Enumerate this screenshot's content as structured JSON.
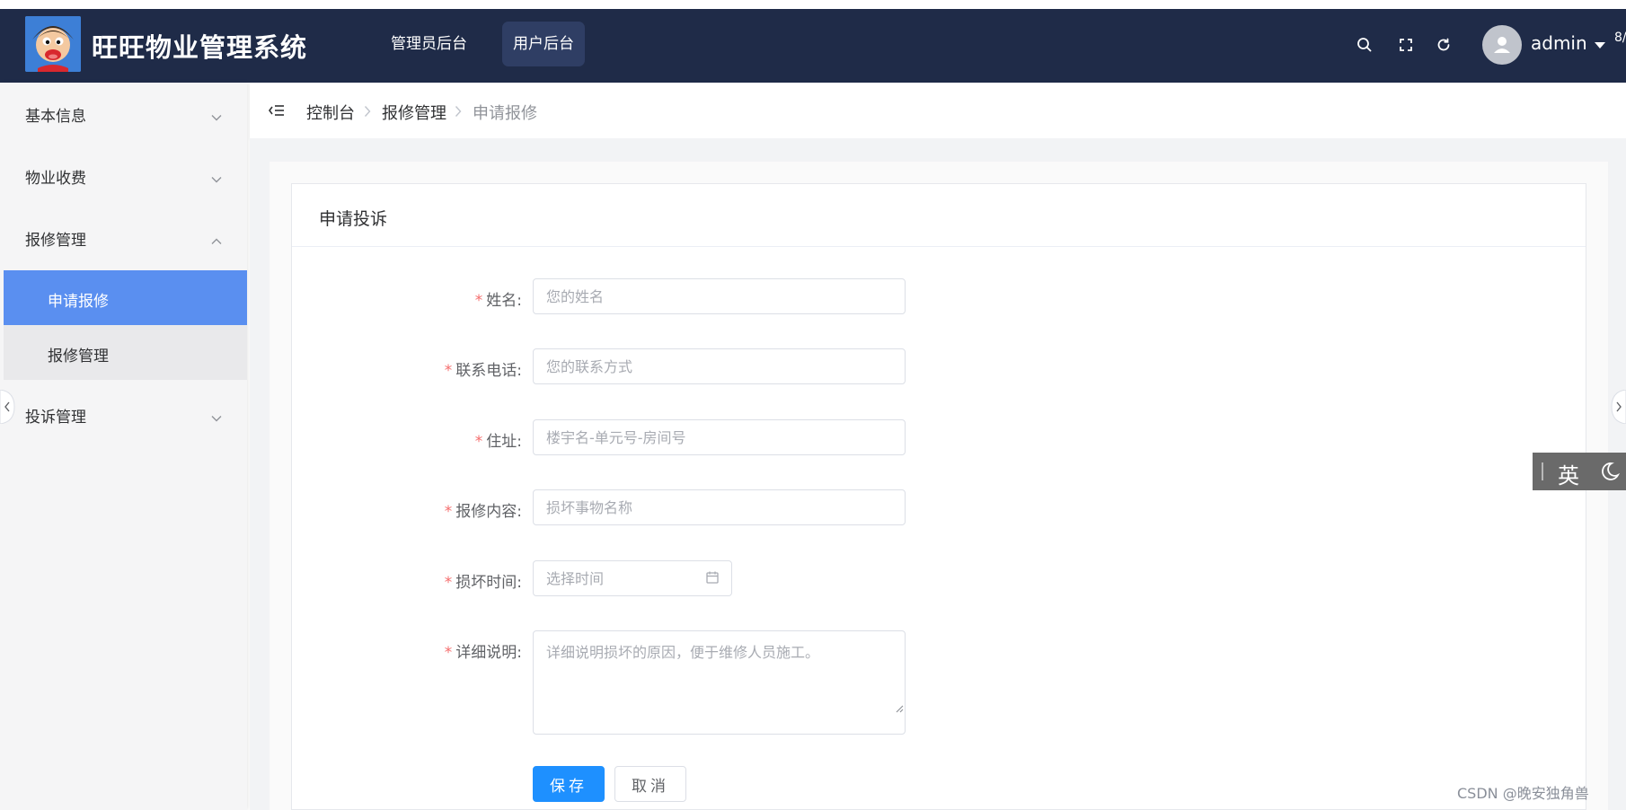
{
  "header": {
    "title": "旺旺物业管理系统",
    "tabs": [
      {
        "label": "管理员后台",
        "active": false
      },
      {
        "label": "用户后台",
        "active": true
      }
    ],
    "icons": [
      "search-icon",
      "fullscreen-icon",
      "refresh-icon"
    ],
    "username": "admin",
    "clipped_text": "8/",
    "background_color": "#1f2b48"
  },
  "sidebar": {
    "items": [
      {
        "label": "基本信息",
        "expanded": false
      },
      {
        "label": "物业收费",
        "expanded": false
      },
      {
        "label": "报修管理",
        "expanded": true,
        "children": [
          {
            "label": "申请报修",
            "active": true
          },
          {
            "label": "报修管理",
            "active": false
          }
        ]
      },
      {
        "label": "投诉管理",
        "expanded": false
      }
    ],
    "active_color": "#5a8ff0"
  },
  "breadcrumb": [
    "控制台",
    "报修管理",
    "申请报修"
  ],
  "card": {
    "title": "申请投诉"
  },
  "form": {
    "name": {
      "label": "姓名:",
      "placeholder": "您的姓名",
      "value": ""
    },
    "phone": {
      "label": "联系电话:",
      "placeholder": "您的联系方式",
      "value": ""
    },
    "address": {
      "label": "住址:",
      "placeholder": "楼宇名-单元号-房间号",
      "value": ""
    },
    "repair_content": {
      "label": "报修内容:",
      "placeholder": "损坏事物名称",
      "value": ""
    },
    "damage_time": {
      "label": "损坏时间:",
      "placeholder": "选择时间",
      "value": ""
    },
    "description": {
      "label": "详细说明:",
      "placeholder": "详细说明损坏的原因，便于维修人员施工。",
      "value": ""
    },
    "required_mark": "*",
    "save_label": "保存",
    "cancel_label": "取消",
    "primary_color": "#1e90ff"
  },
  "ime": {
    "label": "英"
  },
  "watermark": "CSDN @晚安独角兽"
}
